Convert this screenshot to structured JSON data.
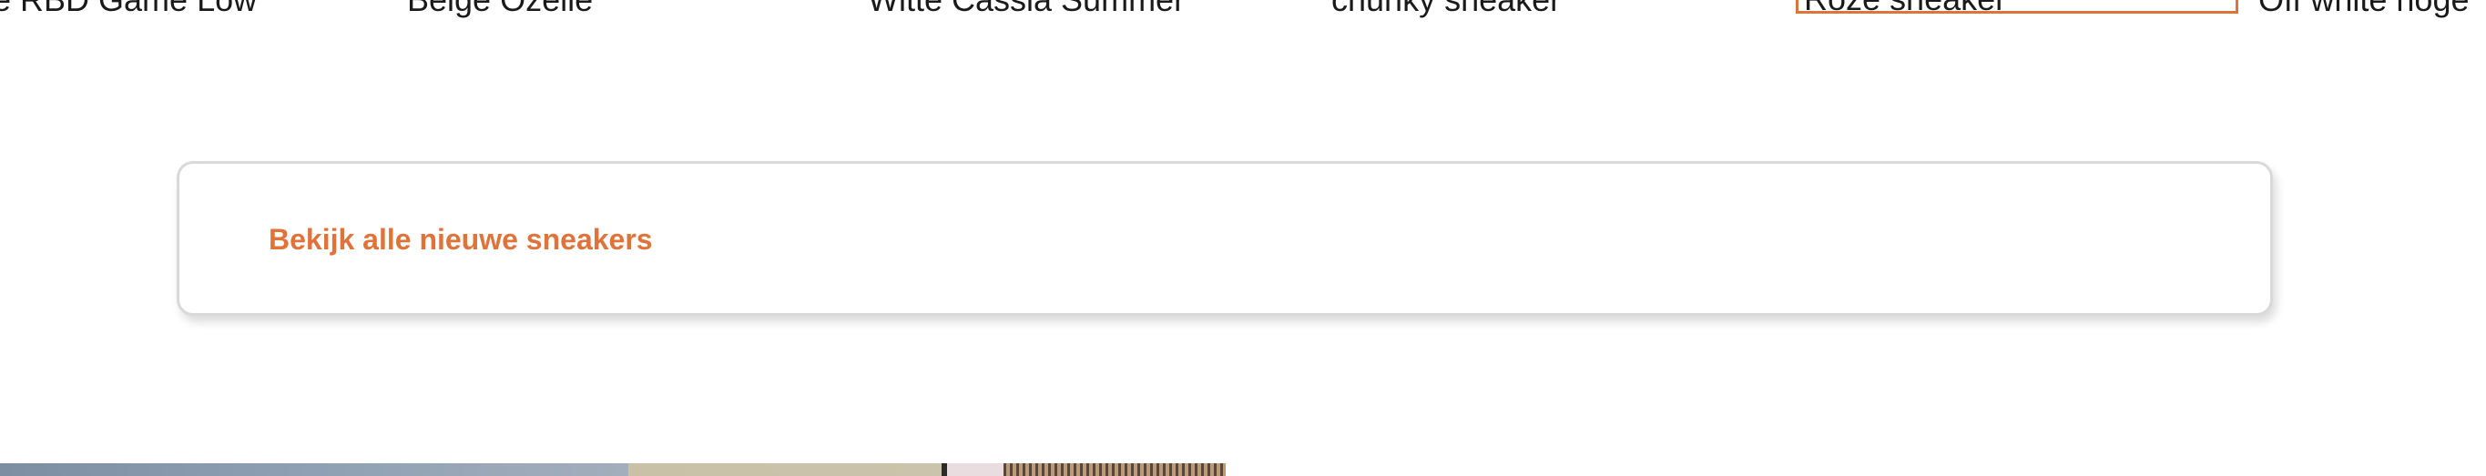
{
  "product_names": [
    "e RBD Game Low",
    "Beige Ozelle",
    "Witte Cassia Summer",
    "chunky sneaker",
    "Roze sneaker",
    "Off white hoge"
  ],
  "cta": {
    "label": "Bekijk alle nieuwe sneakers"
  },
  "colors": {
    "accent": "#e0733a",
    "card_border": "#d9d9d9",
    "text": "#1a1a1a"
  }
}
